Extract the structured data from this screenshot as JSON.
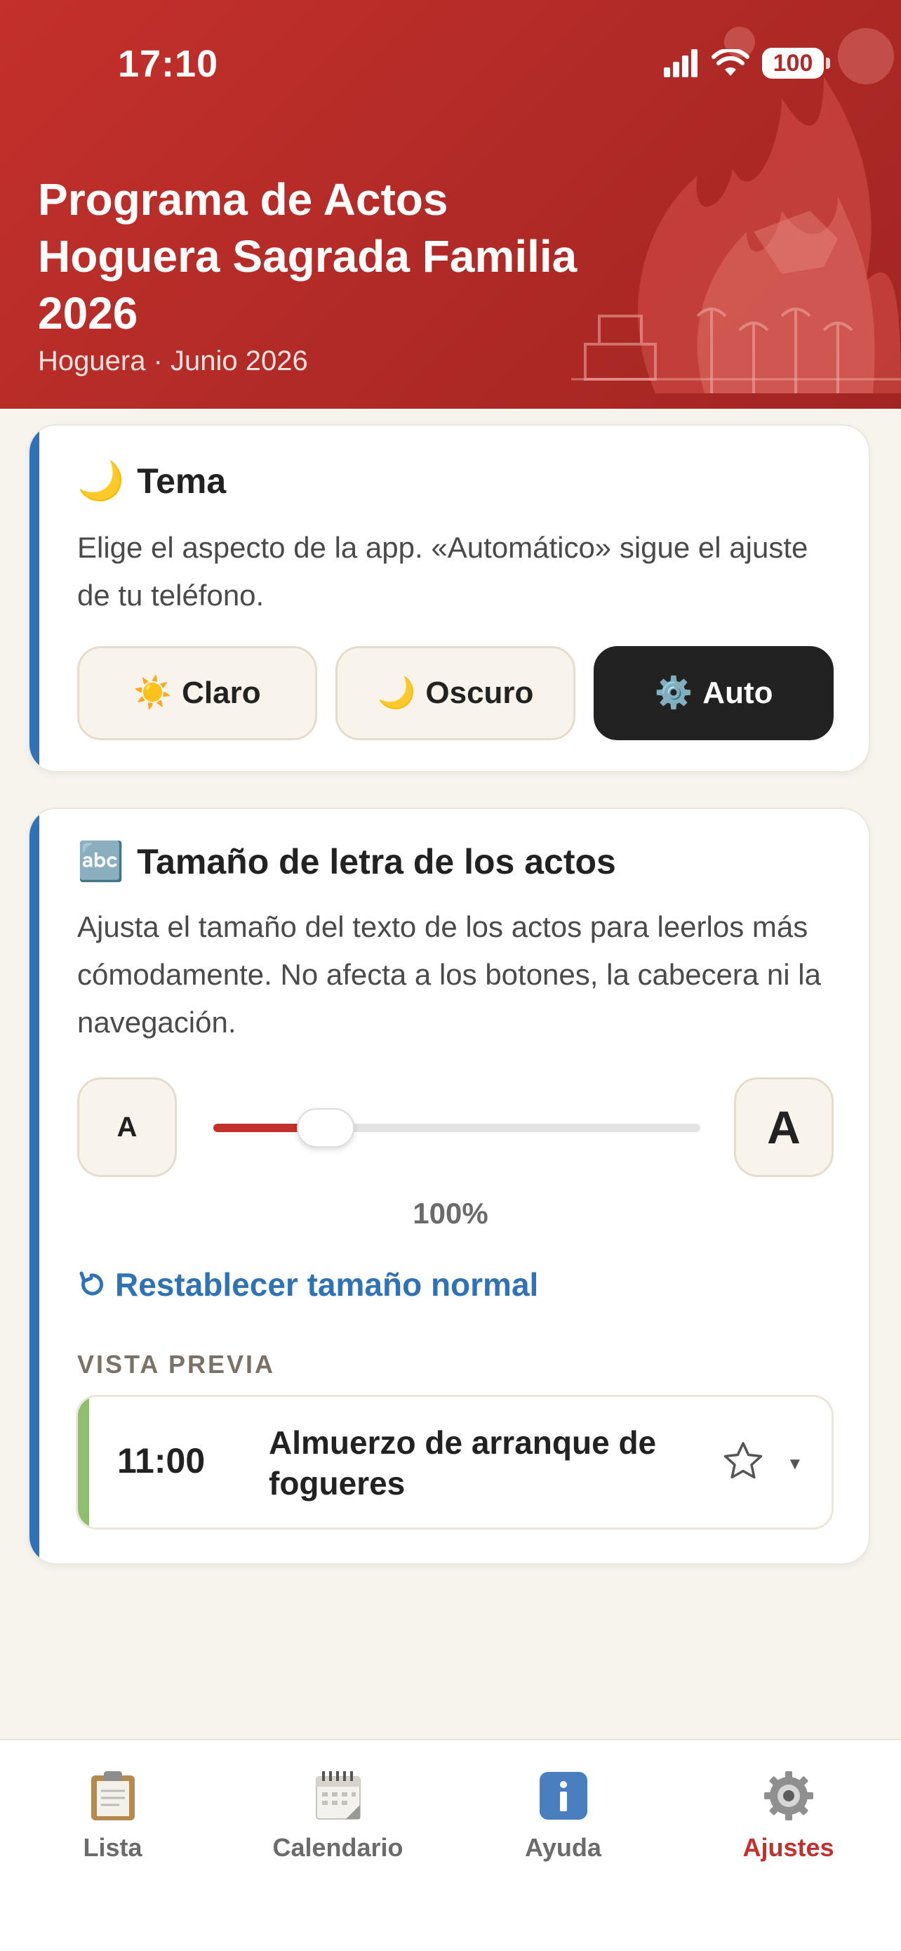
{
  "status_bar": {
    "time": "17:10",
    "battery": "100"
  },
  "header": {
    "title": "Programa de Actos Hoguera Sagrada Familia 2026",
    "subtitle": "Hoguera · Junio 2026"
  },
  "theme_card": {
    "icon": "🌙",
    "title": "Tema",
    "description": "Elige el aspecto de la app. «Automático» sigue el ajuste de tu teléfono.",
    "options": [
      {
        "icon": "☀️",
        "label": "Claro",
        "active": false
      },
      {
        "icon": "🌙",
        "label": "Oscuro",
        "active": false
      },
      {
        "icon": "⚙️",
        "label": "Auto",
        "active": true
      }
    ]
  },
  "font_card": {
    "icon": "🔤",
    "title": "Tamaño de letra de los actos",
    "description": "Ajusta el tamaño del texto de los actos para leerlos más cómodamente. No afecta a los botones, la cabecera ni la navegación.",
    "small_label": "A",
    "large_label": "A",
    "slider_fraction": 0.23,
    "value": "100%",
    "reset_label": "Restablecer tamaño normal",
    "preview_label": "VISTA PREVIA",
    "preview": {
      "time": "11:00",
      "name": "Almuerzo de arranque de fogueres"
    }
  },
  "tabbar": {
    "items": [
      {
        "label": "Lista",
        "icon": "clipboard-icon",
        "active": false
      },
      {
        "label": "Calendario",
        "icon": "calendar-icon",
        "active": false
      },
      {
        "label": "Ayuda",
        "icon": "info-icon",
        "active": false
      },
      {
        "label": "Ajustes",
        "icon": "gear-icon",
        "active": true
      }
    ]
  },
  "colors": {
    "brand_red": "#c4302b",
    "accent_blue": "#2f72b6",
    "preview_green": "#8fbf6e"
  }
}
